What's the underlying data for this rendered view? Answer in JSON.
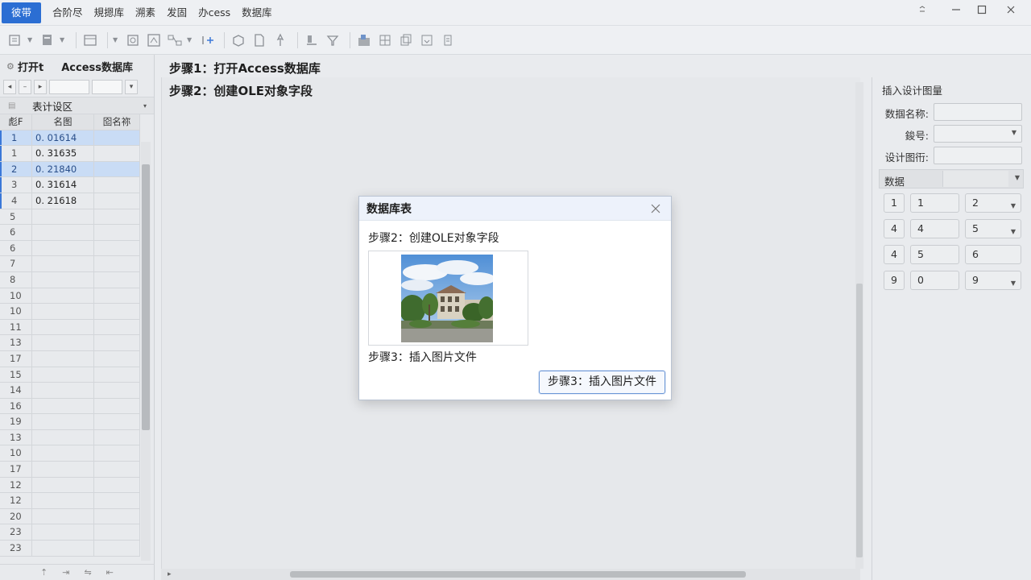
{
  "menu": {
    "items": [
      {
        "label": "彼带",
        "active": true
      },
      {
        "label": "合阶尽",
        "active": false
      },
      {
        "label": "規摁库",
        "active": false
      },
      {
        "label": "溯素",
        "active": false
      },
      {
        "label": "发固",
        "active": false
      },
      {
        "label": "办cess",
        "active": false
      },
      {
        "label": "数据库",
        "active": false
      }
    ]
  },
  "left_panel": {
    "title_prefix": "打开t",
    "title": "Access数据库",
    "section_title": "表计设区",
    "columns": [
      "彪F",
      "名图",
      "囵名祢"
    ],
    "rows": [
      {
        "num": "1",
        "name": "0. 01614",
        "alias": "",
        "state": "sel"
      },
      {
        "num": "1",
        "name": "0. 31635",
        "alias": "",
        "state": "blue"
      },
      {
        "num": "2",
        "name": "0. 21840",
        "alias": "",
        "state": "sel"
      },
      {
        "num": "3",
        "name": "0. 31614",
        "alias": "",
        "state": "blue"
      },
      {
        "num": "4",
        "name": "0. 21618",
        "alias": "",
        "state": "blue"
      },
      {
        "num": "5",
        "name": "",
        "alias": "",
        "state": "blue"
      },
      {
        "num": "6",
        "name": "",
        "alias": "",
        "state": "blue"
      },
      {
        "num": "6",
        "name": "",
        "alias": "",
        "state": "blue"
      },
      {
        "num": "7",
        "name": "",
        "alias": "",
        "state": "blue"
      },
      {
        "num": "8",
        "name": "",
        "alias": "",
        "state": "blue"
      },
      {
        "num": "10",
        "name": "",
        "alias": "",
        "state": "blue"
      },
      {
        "num": "10",
        "name": "",
        "alias": "",
        "state": "blue"
      },
      {
        "num": "11",
        "name": "",
        "alias": "",
        "state": "blue"
      },
      {
        "num": "13",
        "name": "",
        "alias": "",
        "state": "blue"
      },
      {
        "num": "17",
        "name": "",
        "alias": "",
        "state": "blue"
      },
      {
        "num": "15",
        "name": "",
        "alias": "",
        "state": "blue"
      },
      {
        "num": "14",
        "name": "",
        "alias": "",
        "state": "blue"
      },
      {
        "num": "16",
        "name": "",
        "alias": "",
        "state": "blue"
      },
      {
        "num": "19",
        "name": "",
        "alias": "",
        "state": "blue"
      },
      {
        "num": "13",
        "name": "",
        "alias": "",
        "state": "blue"
      },
      {
        "num": "10",
        "name": "",
        "alias": "",
        "state": "blue"
      },
      {
        "num": "17",
        "name": "",
        "alias": "",
        "state": "blue"
      },
      {
        "num": "12",
        "name": "",
        "alias": "",
        "state": "blue"
      },
      {
        "num": "12",
        "name": "",
        "alias": "",
        "state": "blue"
      },
      {
        "num": "20",
        "name": "",
        "alias": "",
        "state": "blue"
      },
      {
        "num": "23",
        "name": "",
        "alias": "",
        "state": "blue"
      },
      {
        "num": "23",
        "name": "",
        "alias": "",
        "state": "blue"
      }
    ]
  },
  "center": {
    "step1": "步骤1：打开Access数据库",
    "step2": "步骤2：创建OLE对象字段"
  },
  "right_panel": {
    "title": "插入设计图量",
    "field1_label": "数掴名称:",
    "field2_label": "鋑号:",
    "field3_label": "设计图衎:",
    "data_label": "数据",
    "grid": [
      [
        "1",
        "1",
        "2"
      ],
      [
        "4",
        "4",
        "5"
      ],
      [
        "4",
        "5",
        "6"
      ],
      [
        "9",
        "0",
        "9"
      ]
    ]
  },
  "dialog": {
    "title": "数据库表",
    "step2": "步骤2：创建OLE对象字段",
    "step3": "步骤3：插入图片文件",
    "button": "步骤3：插入图片文件"
  },
  "colors": {
    "accent": "#2b6ed3",
    "selection": "#c9dcf5",
    "dialog_header": "#edf2fb"
  }
}
